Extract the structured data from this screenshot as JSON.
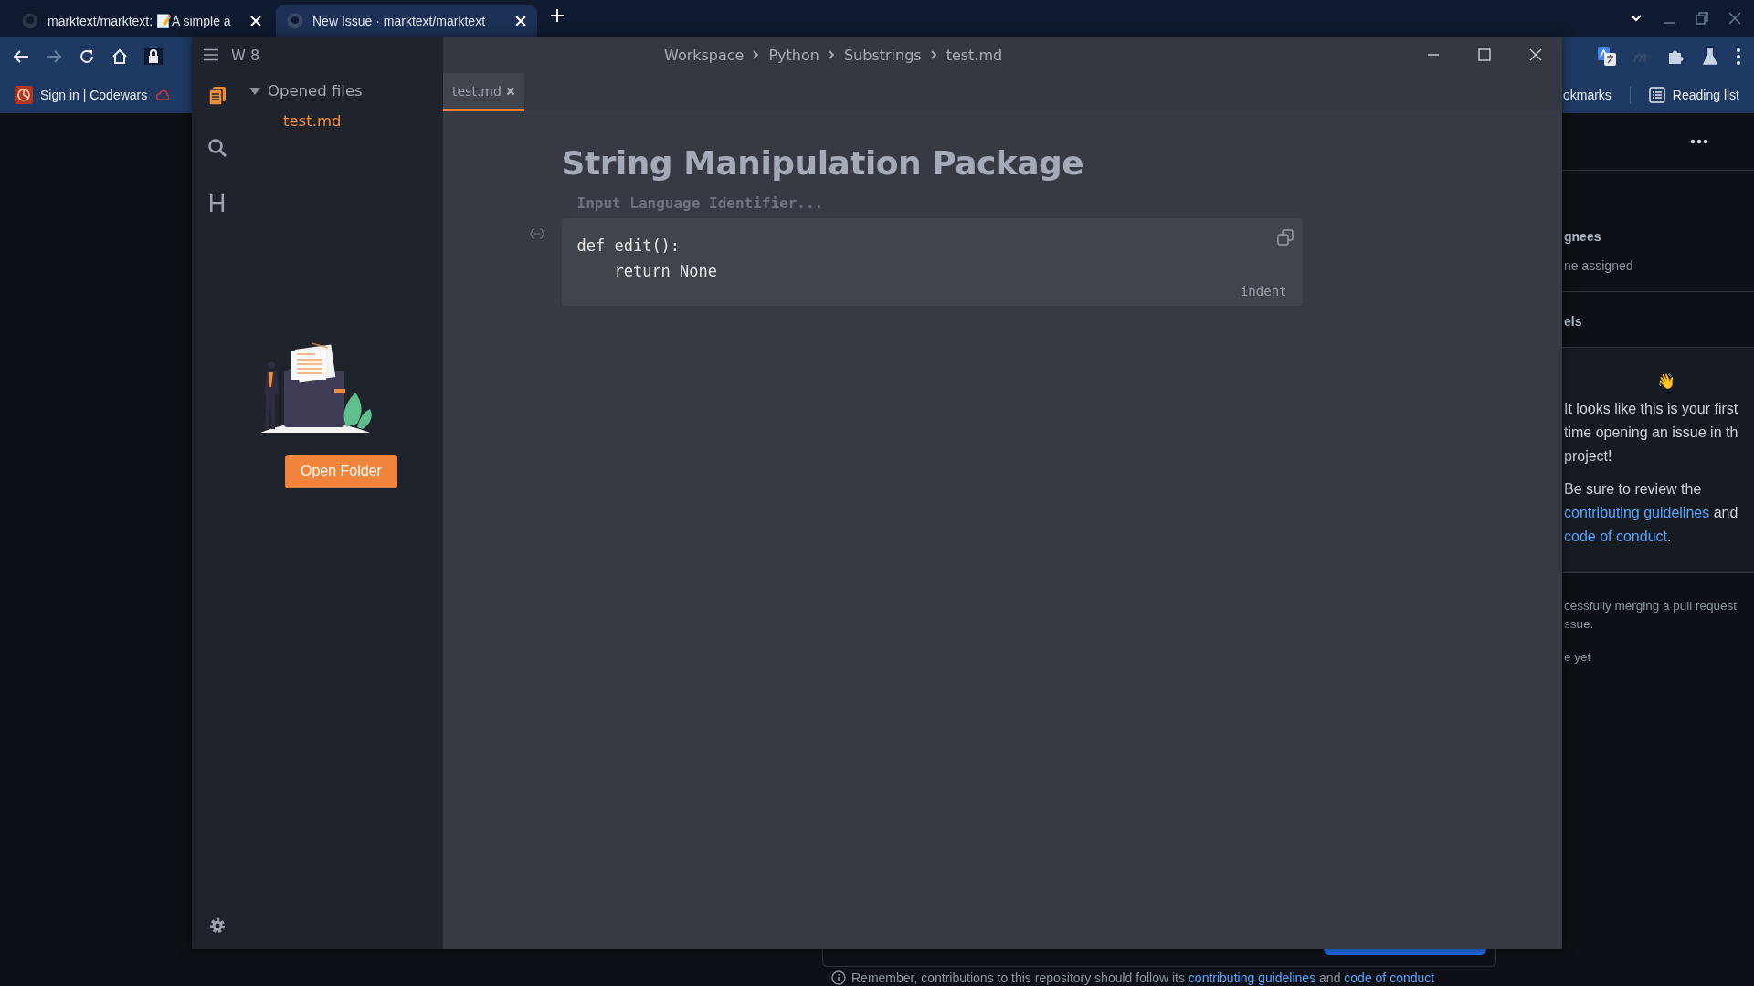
{
  "browser": {
    "tabs": [
      {
        "title": "marktext/marktext: 📝A simple a",
        "selected": false
      },
      {
        "title": "New Issue · marktext/marktext",
        "selected": true
      }
    ],
    "bookmarks": [
      {
        "label": "Sign in | Codewars"
      }
    ],
    "bookmarks_folder": "okmarks",
    "reading_list": "Reading list"
  },
  "marktext": {
    "workspace": "W 8",
    "toc_icon": "H",
    "sidebar_icons": [
      {
        "kind": "files",
        "selected": true
      },
      {
        "kind": "search",
        "selected": false
      },
      {
        "kind": "toc",
        "selected": false
      }
    ],
    "opened_files": {
      "label": "Opened files",
      "expanded": true,
      "files": [
        {
          "name": "test.md",
          "selected": true
        }
      ]
    },
    "open_folder_button": "Open Folder",
    "breadcrumbs": [
      "Workspace",
      "Python",
      "Substrings",
      "test.md"
    ],
    "tabs": [
      {
        "label": "test.md",
        "selected": true
      }
    ],
    "document": {
      "heading": "String Manipulation Package",
      "code_block": {
        "language_placeholder": "Input Language Identifier...",
        "lines": [
          "def edit():",
          "    return None"
        ],
        "mode": "indent"
      }
    }
  },
  "github": {
    "assignees_heading": "gnees",
    "assignees_value": "ne assigned",
    "labels_heading": "els",
    "welcome": {
      "emoji": "👋",
      "lines": [
        "It looks like this is your first",
        "time opening an issue in th",
        "project!"
      ],
      "review_text": "Be sure to review the",
      "link_1": "contributing guidelines",
      "joiner": " and",
      "link_2": "code of conduct",
      "end": "."
    },
    "development_lines": [
      "cessfully merging a pull request",
      "ssue."
    ],
    "development_note": "e yet",
    "notice": {
      "text": "Remember, contributions to this repository should follow its",
      "link_1": "contributing guidelines",
      "joiner": "and",
      "link_2": "code of conduct"
    }
  }
}
